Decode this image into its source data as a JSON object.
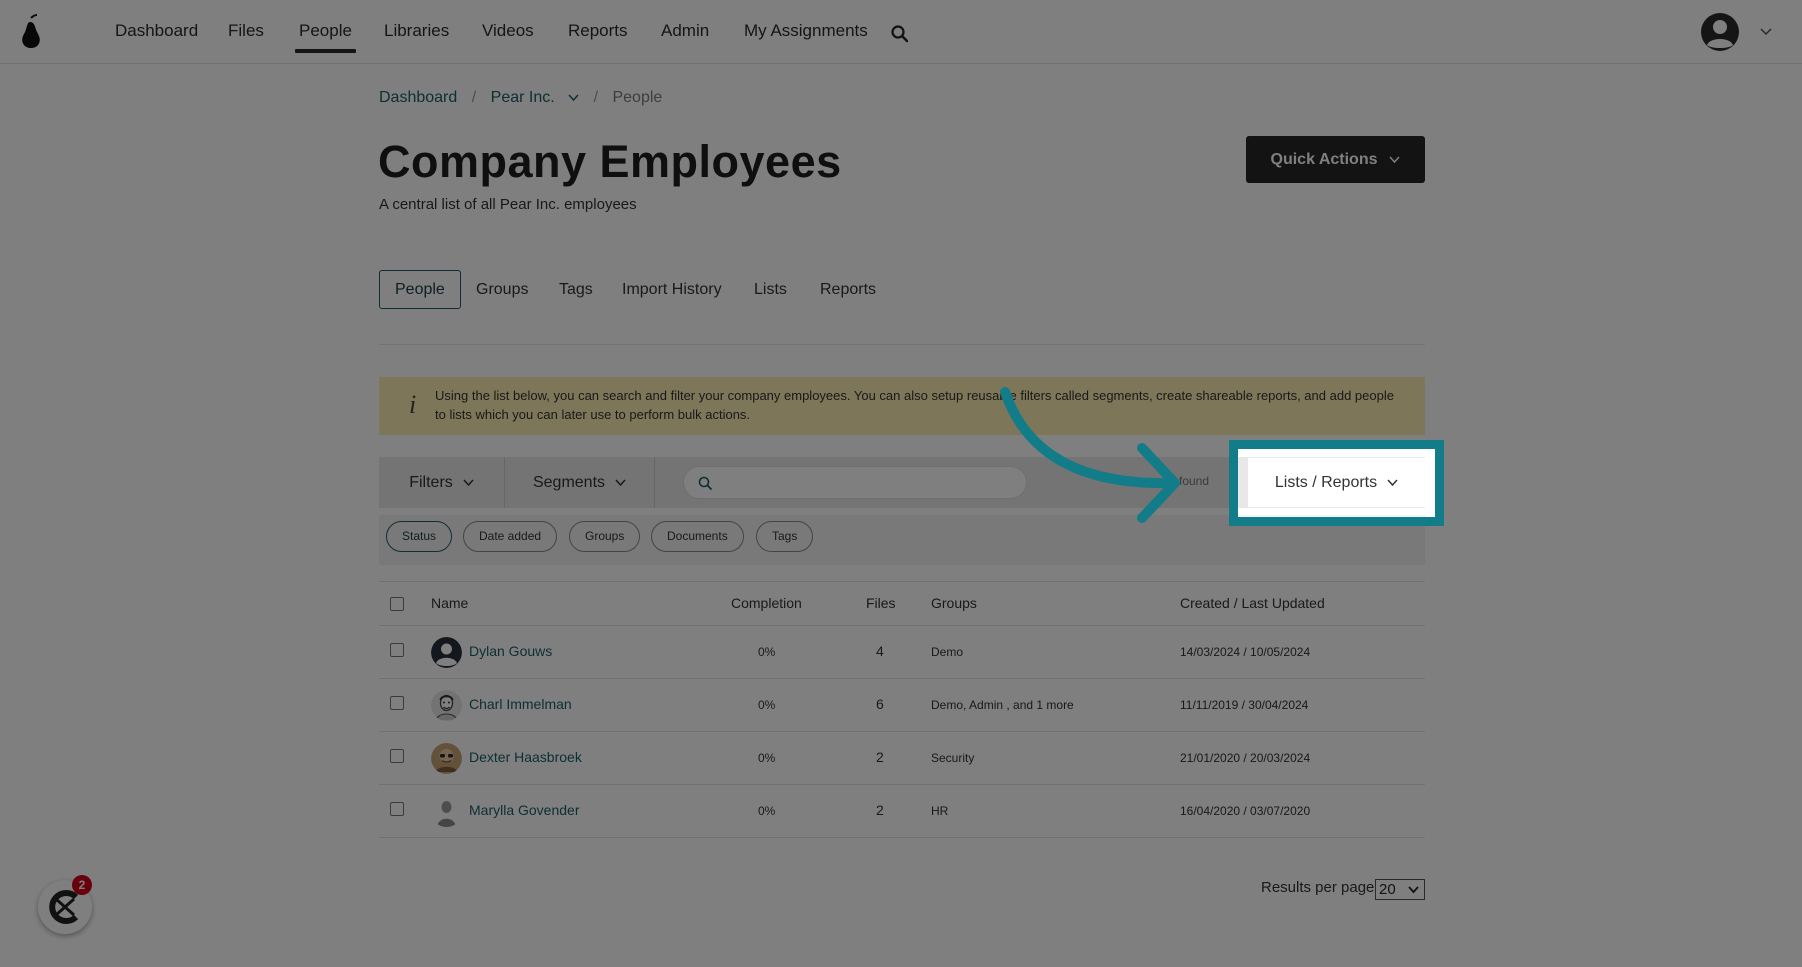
{
  "nav": {
    "items": [
      "Dashboard",
      "Files",
      "People",
      "Libraries",
      "Videos",
      "Reports",
      "Admin",
      "My Assignments"
    ],
    "active": "People"
  },
  "breadcrumb": {
    "home": "Dashboard",
    "company": "Pear Inc.",
    "current": "People",
    "separator": "/"
  },
  "header": {
    "title": "Company Employees",
    "subtitle": "A central list of all Pear Inc. employees",
    "quick_actions_label": "Quick Actions"
  },
  "tabs": [
    "People",
    "Groups",
    "Tags",
    "Import History",
    "Lists",
    "Reports"
  ],
  "info_banner": {
    "icon": "i",
    "text": "Using the list below, you can search and filter your company employees. You can also setup reusable filters called segments, create shareable reports, and add people to lists which you can later use to perform bulk actions."
  },
  "toolbar": {
    "filters_label": "Filters",
    "segments_label": "Segments",
    "search_placeholder": "",
    "found_text": "found",
    "lists_reports_label": "Lists / Reports"
  },
  "filter_chips": [
    "Status",
    "Date added",
    "Groups",
    "Documents",
    "Tags"
  ],
  "table": {
    "columns": [
      "Name",
      "Completion",
      "Files",
      "Groups",
      "Created / Last Updated"
    ],
    "rows": [
      {
        "name": "Dylan Gouws",
        "completion": "0%",
        "files": "4",
        "groups": "Demo",
        "dates": "14/03/2024 / 10/05/2024",
        "avatar": "default-user-icon"
      },
      {
        "name": "Charl Immelman",
        "completion": "0%",
        "files": "6",
        "groups": "Demo, Admin , and 1 more",
        "dates": "11/11/2019 / 30/04/2024",
        "avatar": "sketch-portrait"
      },
      {
        "name": "Dexter Haasbroek",
        "completion": "0%",
        "files": "2",
        "groups": "Security",
        "dates": "21/01/2020 / 20/03/2024",
        "avatar": "photo-portrait"
      },
      {
        "name": "Marylla Govender",
        "completion": "0%",
        "files": "2",
        "groups": "HR",
        "dates": "16/04/2020 / 03/07/2020",
        "avatar": "silhouette-portrait"
      }
    ]
  },
  "pagination": {
    "results_per_page_label": "Results per page:",
    "results_per_page_value": "20"
  },
  "chat": {
    "badge_count": "2"
  },
  "colors": {
    "accent": "#1b5e67",
    "highlight": "#137c89",
    "banner": "#fbecb2",
    "badge": "#d0021b"
  }
}
